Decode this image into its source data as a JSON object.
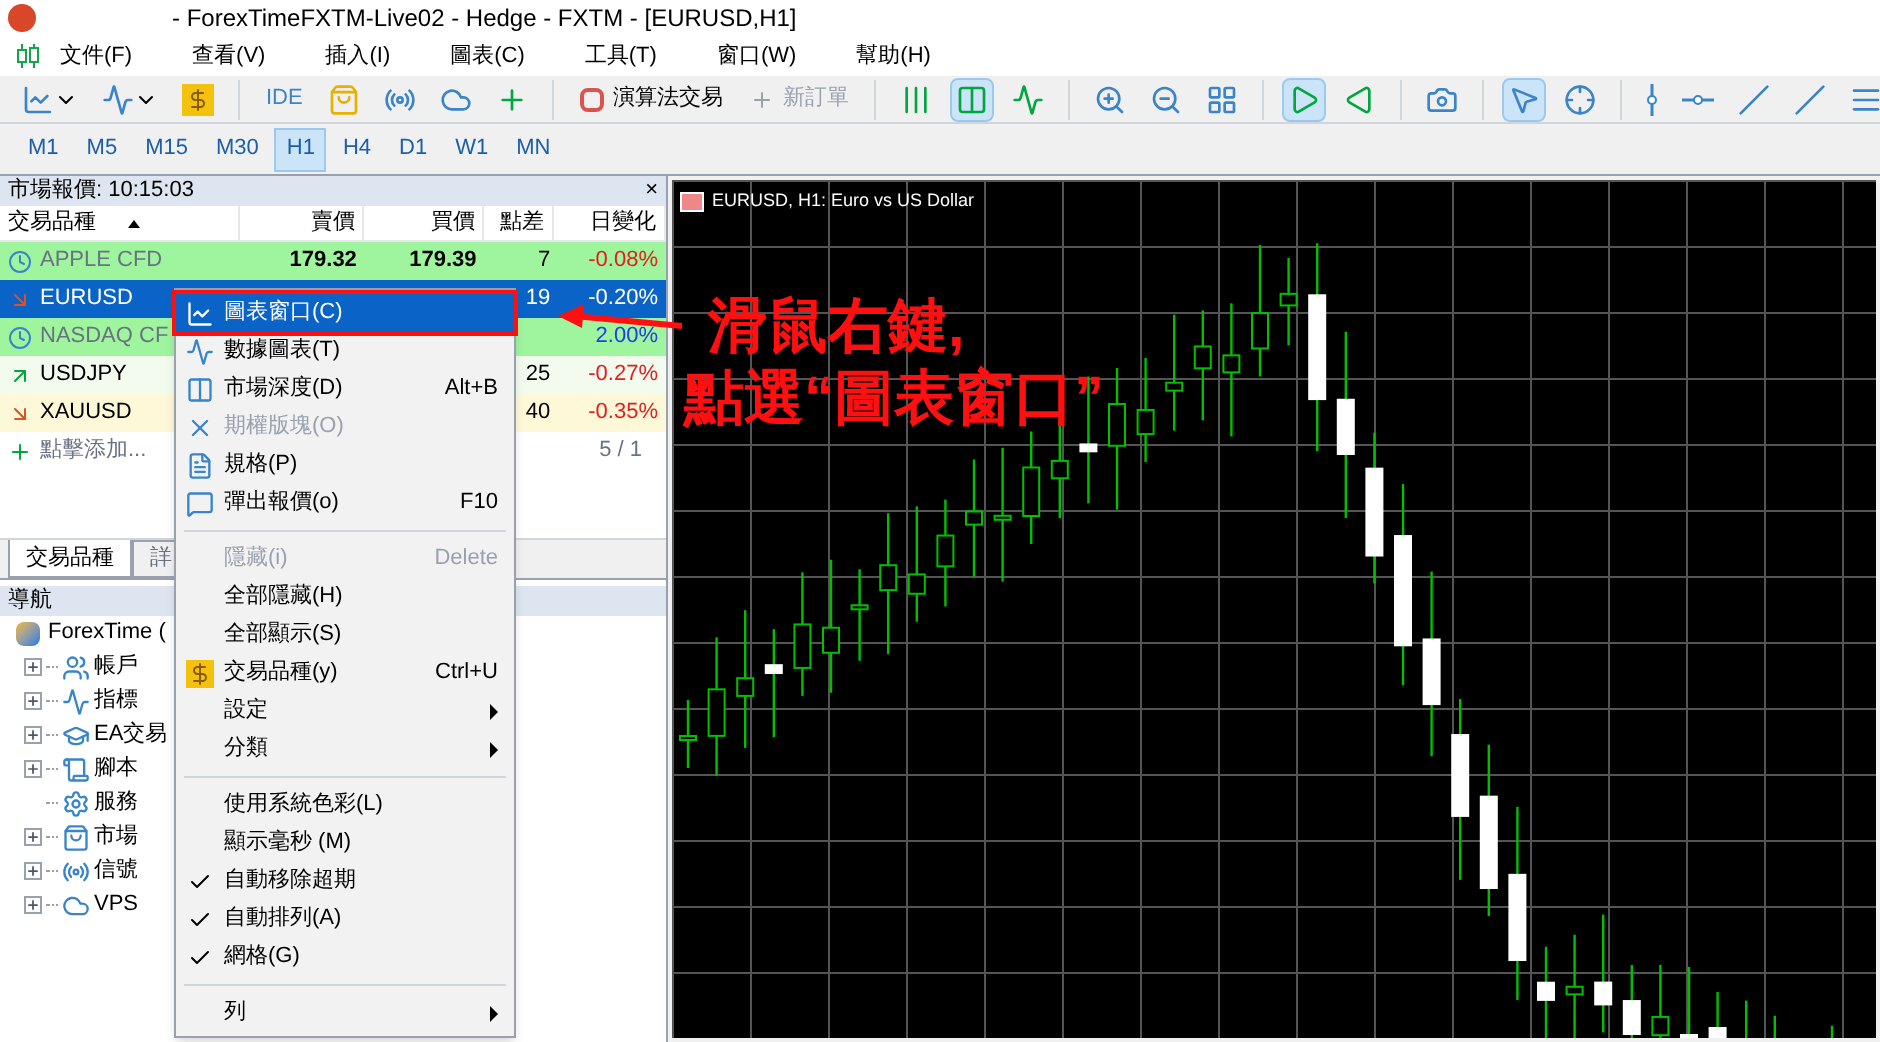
{
  "window": {
    "title": "- ForexTimeFXTM-Live02 - Hedge - FXTM - [EURUSD,H1]"
  },
  "menu": [
    "文件(F)",
    "查看(V)",
    "插入(I)",
    "圖表(C)",
    "工具(T)",
    "窗口(W)",
    "幫助(H)"
  ],
  "toolbar": {
    "ide": "IDE",
    "algo_trading": "演算法交易",
    "new_order": {
      "label": "新訂單",
      "disabled": true
    },
    "chart_types": [
      {
        "selected": false
      },
      {
        "selected": true
      },
      {
        "selected": false
      }
    ],
    "autoscroll": {
      "selected": true
    },
    "chart_shift": {
      "selected": false
    },
    "tools": [
      {
        "selected": true
      },
      {
        "selected": false
      }
    ]
  },
  "timeframes": [
    {
      "label": "M1",
      "selected": false
    },
    {
      "label": "M5",
      "selected": false
    },
    {
      "label": "M15",
      "selected": false
    },
    {
      "label": "M30",
      "selected": false
    },
    {
      "label": "H1",
      "selected": true
    },
    {
      "label": "H4",
      "selected": false
    },
    {
      "label": "D1",
      "selected": false
    },
    {
      "label": "W1",
      "selected": false
    },
    {
      "label": "MN",
      "selected": false
    }
  ],
  "market_watch": {
    "title": "市場報價: 10:15:03",
    "close": "×",
    "columns": [
      "交易品種",
      "賣價",
      "買價",
      "點差",
      "日變化"
    ],
    "rows": [
      {
        "symbol": "APPLE CFD",
        "kind": "closed",
        "bid": "179.32",
        "ask": "179.39",
        "spread": "7",
        "change": "-0.08%",
        "selected": false
      },
      {
        "symbol": "EURUSD",
        "kind": "down",
        "spread": "19",
        "change": "-0.20%",
        "selected": true
      },
      {
        "symbol": "NASDAQ CF",
        "kind": "closed",
        "change": "2.00%",
        "selected": false
      },
      {
        "symbol": "USDJPY",
        "kind": "up",
        "spread": "25",
        "change": "-0.27%",
        "selected": false
      },
      {
        "symbol": "XAUUSD",
        "kind": "down",
        "spread": "40",
        "change": "-0.35%",
        "selected": false
      }
    ],
    "add_row": "點擊添加...",
    "count": "5 / 1",
    "tabs": [
      {
        "label": "交易品種",
        "selected": true
      },
      {
        "label": "詳",
        "selected": false
      }
    ]
  },
  "navigator": {
    "title": "導航",
    "root": "ForexTime (",
    "children": [
      {
        "label": "帳戶",
        "expandable": true
      },
      {
        "label": "指標",
        "expandable": true
      },
      {
        "label": "EA交易",
        "expandable": true
      },
      {
        "label": "腳本",
        "expandable": true
      },
      {
        "label": "服務",
        "expandable": false
      },
      {
        "label": "市場",
        "expandable": true
      },
      {
        "label": "信號",
        "expandable": true
      },
      {
        "label": "VPS",
        "expandable": true
      }
    ]
  },
  "chart": {
    "title": "EURUSD, H1: Euro vs US Dollar"
  },
  "context_menu": [
    {
      "kind": "item",
      "label": "圖表窗口(C)",
      "selected": true
    },
    {
      "kind": "item",
      "label": "數據圖表(T)",
      "selected": false
    },
    {
      "kind": "item",
      "label": "市場深度(D)",
      "shortcut": "Alt+B",
      "selected": false
    },
    {
      "kind": "item",
      "label": "期權版塊(O)",
      "disabled": true,
      "selected": false
    },
    {
      "kind": "item",
      "label": "規格(P)",
      "selected": false
    },
    {
      "kind": "item",
      "label": "彈出報價(o)",
      "shortcut": "F10",
      "selected": false
    },
    {
      "kind": "separator"
    },
    {
      "kind": "item",
      "label": "隱藏(i)",
      "shortcut": "Delete",
      "disabled": true,
      "selected": false
    },
    {
      "kind": "item",
      "label": "全部隱藏(H)",
      "selected": false
    },
    {
      "kind": "item",
      "label": "全部顯示(S)",
      "selected": false
    },
    {
      "kind": "item",
      "label": "交易品種(y)",
      "shortcut": "Ctrl+U",
      "selected": false
    },
    {
      "kind": "item",
      "label": "設定",
      "submenu": true,
      "selected": false
    },
    {
      "kind": "item",
      "label": "分類",
      "submenu": true,
      "selected": false
    },
    {
      "kind": "separator"
    },
    {
      "kind": "item",
      "label": "使用系統色彩(L)",
      "selected": false
    },
    {
      "kind": "item",
      "label": "顯示毫秒 (M)",
      "selected": false
    },
    {
      "kind": "item",
      "label": "自動移除超期",
      "checked": true,
      "selected": false
    },
    {
      "kind": "item",
      "label": "自動排列(A)",
      "checked": true,
      "selected": false
    },
    {
      "kind": "item",
      "label": "網格(G)",
      "checked": true,
      "selected": false
    },
    {
      "kind": "separator"
    },
    {
      "kind": "item",
      "label": "列",
      "submenu": true,
      "selected": false
    }
  ],
  "annotation": [
    "滑鼠右鍵,",
    "點選“圖表窗口”"
  ]
}
